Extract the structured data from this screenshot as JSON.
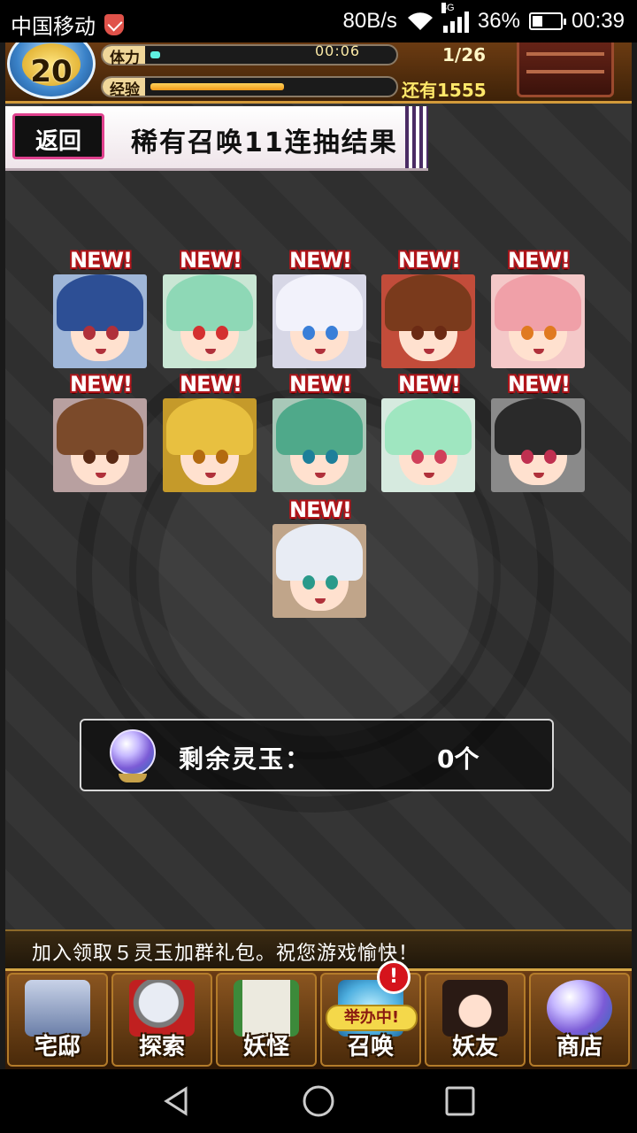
{
  "status_bar": {
    "carrier": "中国移动",
    "net_speed": "80B/s",
    "network_type": "3G",
    "battery_percent": "36%",
    "battery_level": 0.36,
    "time": "00:39"
  },
  "hud": {
    "level": "20",
    "stamina_label": "体力",
    "stamina_fill": 0.04,
    "stamina_timer": "00:06",
    "stamina_count": "1/26",
    "exp_label": "经验",
    "exp_fill": 0.56,
    "exp_remaining": "还有1555"
  },
  "banner": {
    "back_label": "返回",
    "title": "稀有召唤11连抽结果"
  },
  "results": {
    "new_badge": "NEW!",
    "cards": [
      {
        "hair": "#2d4f95",
        "eye": "#b0303a",
        "bg": "#9fb6d8"
      },
      {
        "hair": "#8ed8b6",
        "eye": "#d43030",
        "bg": "#c9e6d4"
      },
      {
        "hair": "#f2f2fb",
        "eye": "#3a7fd8",
        "bg": "#d7d7e6"
      },
      {
        "hair": "#7a3a1c",
        "eye": "#6b2a14",
        "bg": "#c24c3a"
      },
      {
        "hair": "#f0a0a8",
        "eye": "#e07a20",
        "bg": "#f4c8c8"
      },
      {
        "hair": "#7b4a2a",
        "eye": "#5a2a14",
        "bg": "#b8a0a0"
      },
      {
        "hair": "#e8c040",
        "eye": "#b36a10",
        "bg": "#c59a2a"
      },
      {
        "hair": "#4fa98a",
        "eye": "#1d7f9a",
        "bg": "#a8c8b8"
      },
      {
        "hair": "#9fe6c0",
        "eye": "#d0405a",
        "bg": "#d6eadf"
      },
      {
        "hair": "#2a2a2a",
        "eye": "#c03050",
        "bg": "#8a8a8a"
      },
      {
        "hair": "#e8ecf4",
        "eye": "#2a9a8a",
        "bg": "#c0a58a"
      }
    ]
  },
  "jade": {
    "label": "剩余灵玉：",
    "value": "0个"
  },
  "ticker": {
    "text": "加入领取５灵玉加群礼包。祝您游戏愉快！"
  },
  "nav": {
    "items": [
      {
        "label": "宅邸",
        "icon": "mansion-icon"
      },
      {
        "label": "探索",
        "icon": "magnifier-map-icon"
      },
      {
        "label": "妖怪",
        "icon": "yokai-scroll-icon"
      },
      {
        "label": "召唤",
        "icon": "summon-icon",
        "event_tag": "举办中!",
        "alert": "!"
      },
      {
        "label": "妖友",
        "icon": "friend-catgirl-icon"
      },
      {
        "label": "商店",
        "icon": "crystal-orb-icon"
      }
    ]
  },
  "system_nav": {
    "back_icon": "triangle-back-icon",
    "home_icon": "circle-home-icon",
    "recents_icon": "square-recents-icon"
  }
}
